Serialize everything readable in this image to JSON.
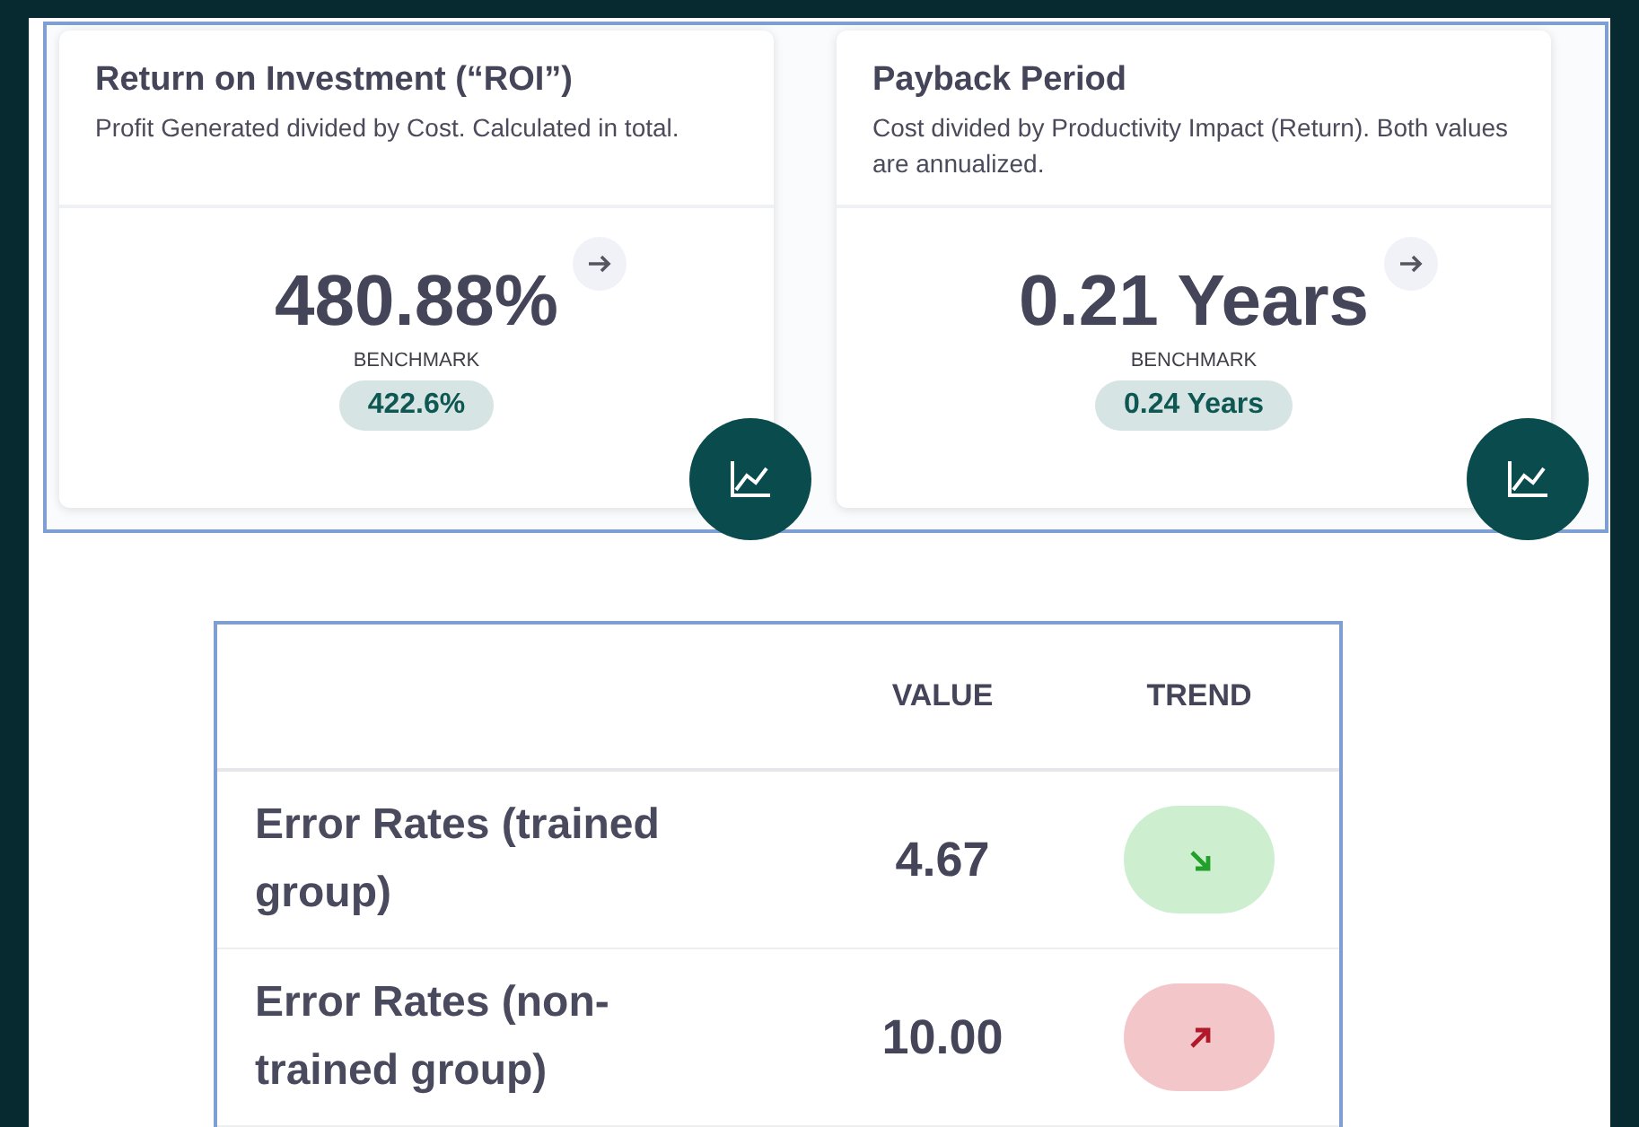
{
  "cards": [
    {
      "title": "Return on Investment (“ROI”)",
      "description": "Profit Generated divided by Cost. Calculated in total.",
      "value": "480.88%",
      "benchmark_label": "BENCHMARK",
      "benchmark": "422.6%"
    },
    {
      "title": "Payback Period",
      "description": "Cost divided by Productivity Impact (Return). Both values are annualized.",
      "value": "0.21 Years",
      "benchmark_label": "BENCHMARK",
      "benchmark": "0.24 Years"
    }
  ],
  "table": {
    "columns": [
      "VALUE",
      "TREND"
    ],
    "rows": [
      {
        "label": "Error Rates (trained group)",
        "value": "4.67",
        "trend": {
          "kind": "down"
        }
      },
      {
        "label": "Error Rates (non-trained group)",
        "value": "10.00",
        "trend": {
          "kind": "up"
        }
      }
    ]
  }
}
